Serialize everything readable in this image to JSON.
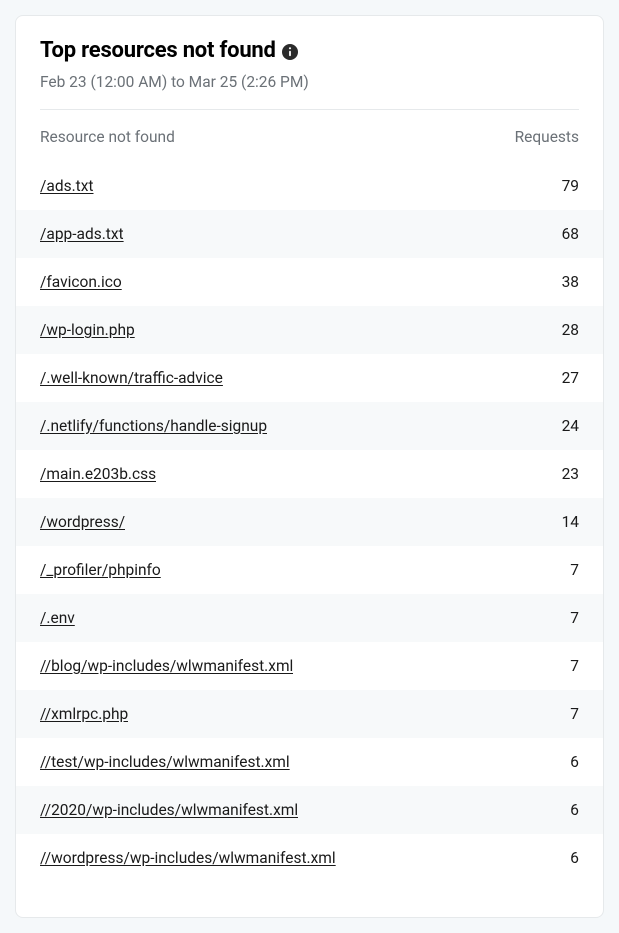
{
  "header": {
    "title": "Top resources not found",
    "date_range": "Feb 23 (12:00 AM) to Mar 25 (2:26 PM)"
  },
  "columns": {
    "resource_label": "Resource not found",
    "requests_label": "Requests"
  },
  "rows": [
    {
      "resource": "/ads.txt",
      "requests": 79
    },
    {
      "resource": "/app-ads.txt",
      "requests": 68
    },
    {
      "resource": "/favicon.ico",
      "requests": 38
    },
    {
      "resource": "/wp-login.php",
      "requests": 28
    },
    {
      "resource": "/.well-known/traffic-advice",
      "requests": 27
    },
    {
      "resource": "/.netlify/functions/handle-signup",
      "requests": 24
    },
    {
      "resource": "/main.e203b.css",
      "requests": 23
    },
    {
      "resource": "/wordpress/",
      "requests": 14
    },
    {
      "resource": "/_profiler/phpinfo",
      "requests": 7
    },
    {
      "resource": "/.env",
      "requests": 7
    },
    {
      "resource": "//blog/wp-includes/wlwmanifest.xml",
      "requests": 7
    },
    {
      "resource": "//xmlrpc.php",
      "requests": 7
    },
    {
      "resource": "//test/wp-includes/wlwmanifest.xml",
      "requests": 6
    },
    {
      "resource": "//2020/wp-includes/wlwmanifest.xml",
      "requests": 6
    },
    {
      "resource": "//wordpress/wp-includes/wlwmanifest.xml",
      "requests": 6
    }
  ],
  "chart_data": {
    "type": "table",
    "title": "Top resources not found",
    "columns": [
      "Resource not found",
      "Requests"
    ],
    "rows": [
      [
        "/ads.txt",
        79
      ],
      [
        "/app-ads.txt",
        68
      ],
      [
        "/favicon.ico",
        38
      ],
      [
        "/wp-login.php",
        28
      ],
      [
        "/.well-known/traffic-advice",
        27
      ],
      [
        "/.netlify/functions/handle-signup",
        24
      ],
      [
        "/main.e203b.css",
        23
      ],
      [
        "/wordpress/",
        14
      ],
      [
        "/_profiler/phpinfo",
        7
      ],
      [
        "/.env",
        7
      ],
      [
        "//blog/wp-includes/wlwmanifest.xml",
        7
      ],
      [
        "//xmlrpc.php",
        7
      ],
      [
        "//test/wp-includes/wlwmanifest.xml",
        6
      ],
      [
        "//2020/wp-includes/wlwmanifest.xml",
        6
      ],
      [
        "//wordpress/wp-includes/wlwmanifest.xml",
        6
      ]
    ]
  }
}
